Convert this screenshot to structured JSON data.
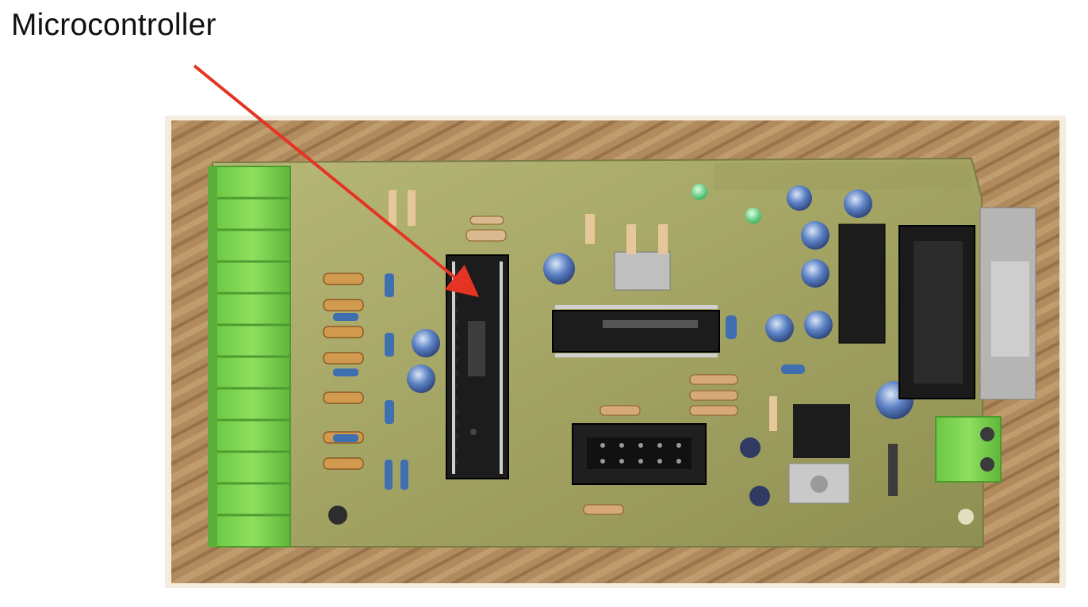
{
  "annotation": {
    "label": "Microcontroller",
    "arrow_color": "#e53324"
  },
  "photo": {
    "subject": "pcb-board-photo",
    "board_color": "#a9ac66",
    "background_color": "#b08a5c",
    "terminal_color": "#7fd44e"
  }
}
